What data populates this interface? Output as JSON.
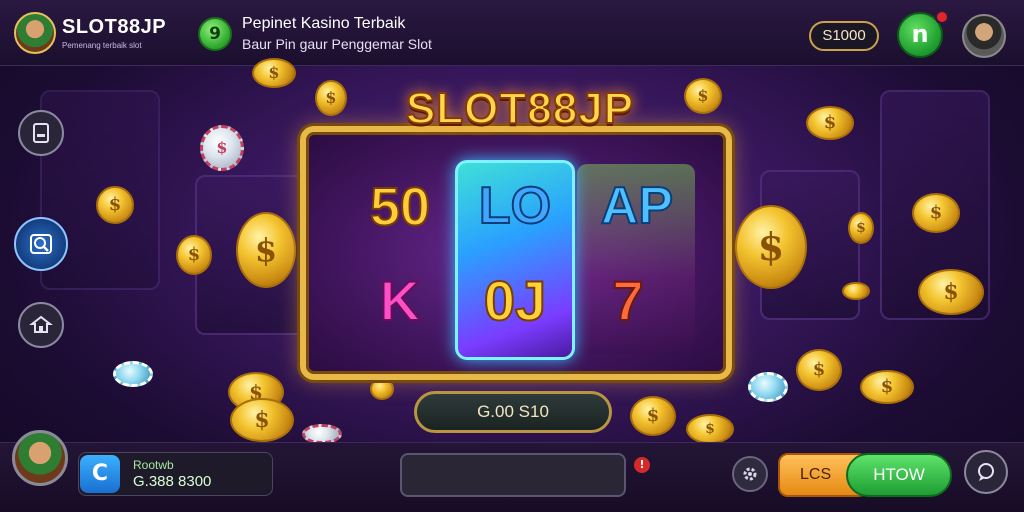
{
  "header": {
    "brand_title": "SLOT88JP",
    "brand_subtitle": "Pemenang terbaik slot",
    "promo_badge": "9",
    "promo_title": "Pepinet Kasino Terbaik",
    "promo_subtitle": "Baur Pin gaur Penggemar Slot",
    "balance": "S1000",
    "notify_badge": "n"
  },
  "game": {
    "title": "SLOT88JP",
    "reel_symbols": [
      "50",
      "LO",
      "AP",
      "K",
      "0J",
      "7"
    ],
    "bet_display": "G.00 S10"
  },
  "footer": {
    "wallet_label": "Rootwb",
    "wallet_value": "G.388 8300",
    "wallet_icon": "C",
    "alert": "!",
    "left_button": "LCS",
    "right_button": "HTOW"
  },
  "icons": {
    "side_1": "card-icon",
    "side_2": "search-icon",
    "side_3": "house-icon",
    "settings": "gear-icon",
    "menu": "chat-icon"
  },
  "colors": {
    "title_gold": "#ffd84a",
    "frame_gold": "#e7b949",
    "accent_green": "#1e9e34",
    "accent_orange": "#e68a14",
    "background_purple": "#3a1860"
  }
}
